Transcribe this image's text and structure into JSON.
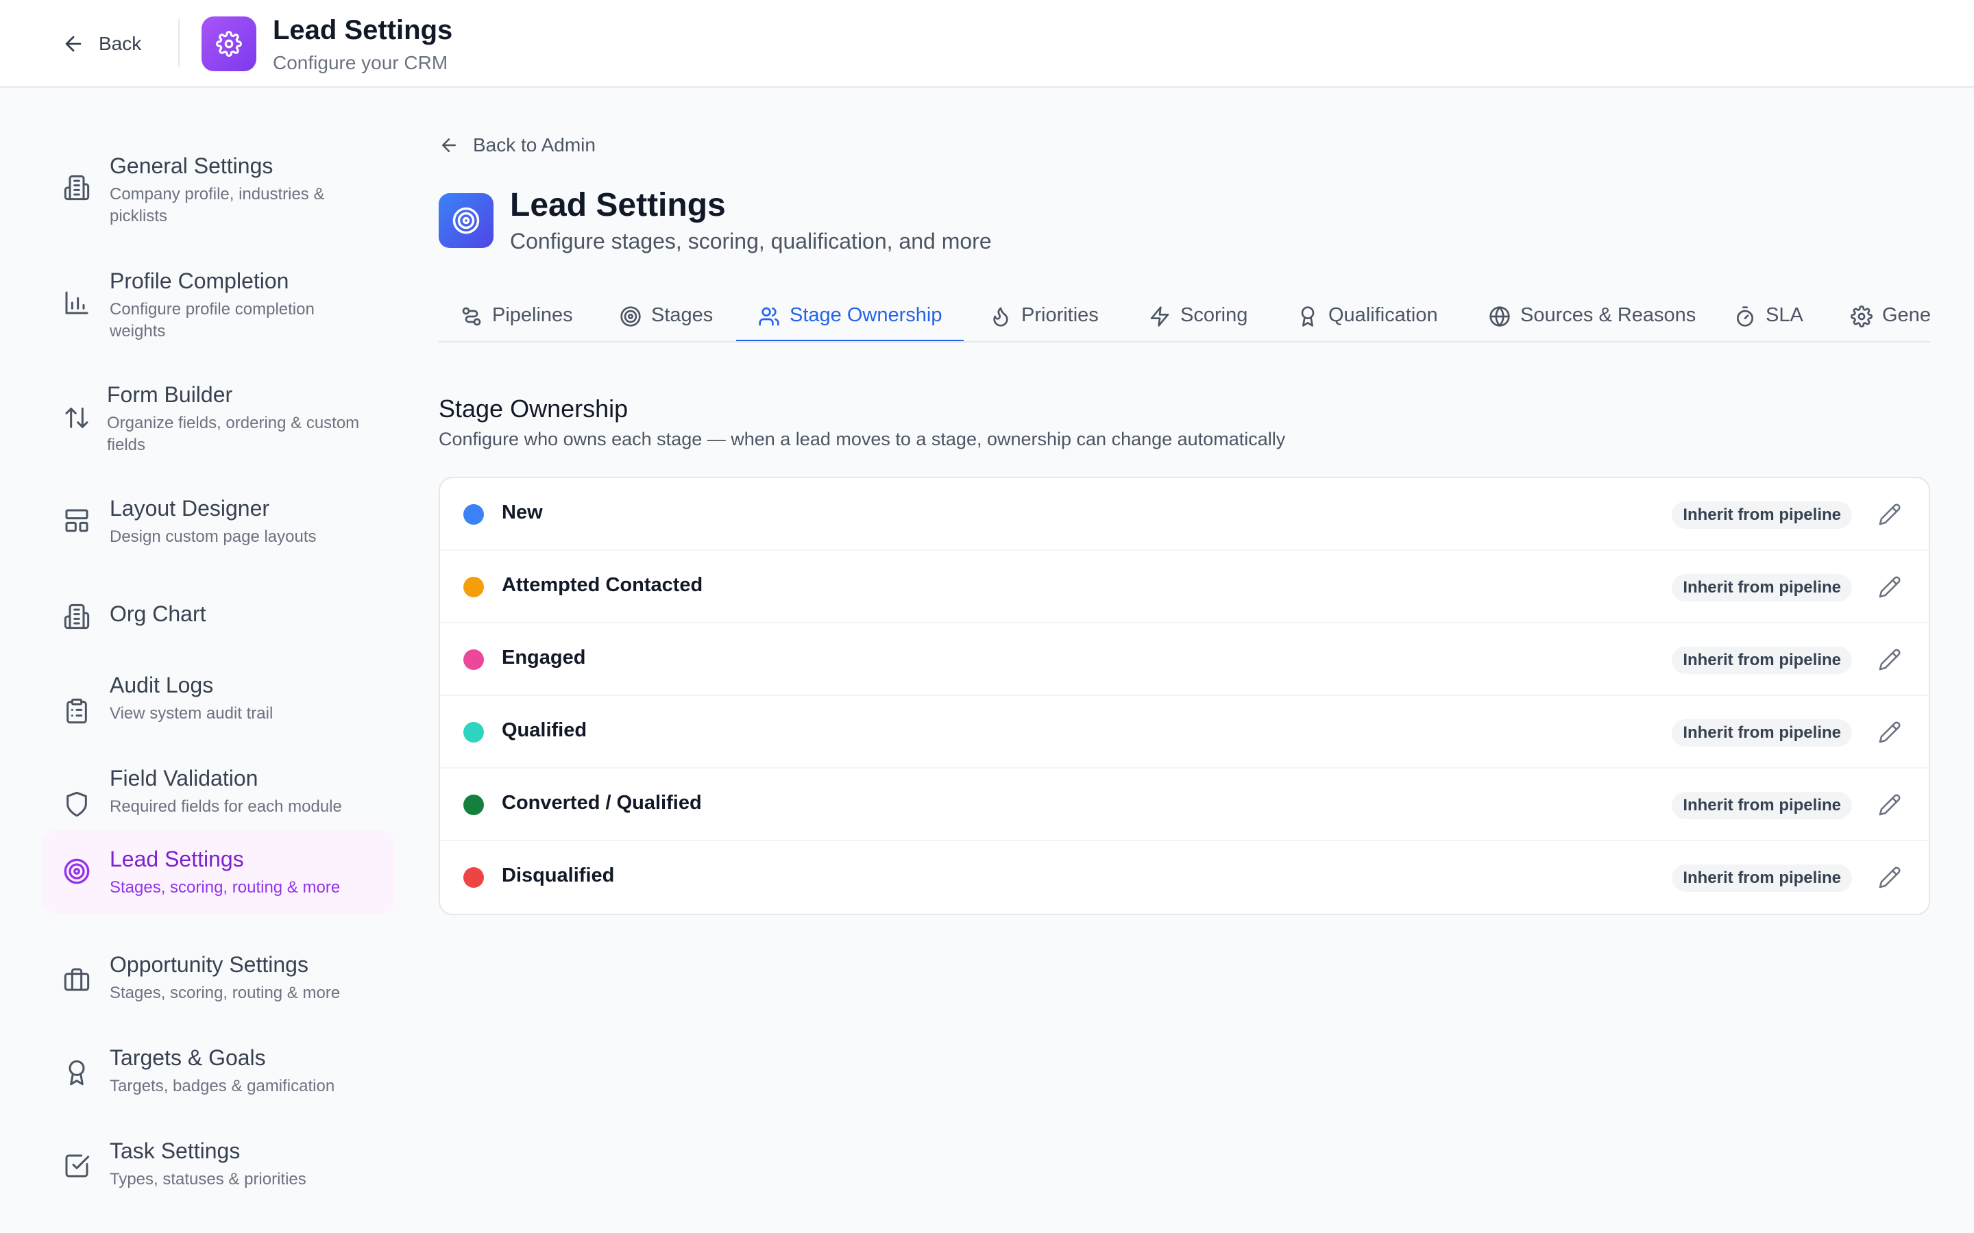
{
  "topbar": {
    "back_label": "Back",
    "title": "Lead Settings",
    "subtitle": "Configure your CRM",
    "icon": "gear-icon"
  },
  "sidebar": {
    "items": [
      {
        "title": "General Settings",
        "desc": "Company profile, industries & picklists",
        "icon": "building-icon"
      },
      {
        "title": "Profile Completion",
        "desc": "Configure profile completion weights",
        "icon": "bar-chart-icon"
      },
      {
        "title": "Form Builder",
        "desc": "Organize fields, ordering & custom fields",
        "icon": "sort-arrows-icon"
      },
      {
        "title": "Layout Designer",
        "desc": "Design custom page layouts",
        "icon": "layout-icon"
      },
      {
        "title": "Org Chart",
        "desc": "",
        "icon": "building-icon"
      },
      {
        "title": "Audit Logs",
        "desc": "View system audit trail",
        "icon": "clipboard-icon"
      },
      {
        "title": "Field Validation",
        "desc": "Required fields for each module",
        "icon": "shield-icon"
      },
      {
        "title": "Lead Settings",
        "desc": "Stages, scoring, routing & more",
        "icon": "target-icon",
        "active": true
      },
      {
        "title": "Opportunity Settings",
        "desc": "Stages, scoring, routing & more",
        "icon": "briefcase-icon"
      },
      {
        "title": "Targets & Goals",
        "desc": "Targets, badges & gamification",
        "icon": "award-icon"
      },
      {
        "title": "Task Settings",
        "desc": "Types, statuses & priorities",
        "icon": "checkbox-icon"
      }
    ]
  },
  "main": {
    "back_label": "Back to Admin",
    "title": "Lead Settings",
    "subtitle": "Configure stages, scoring, qualification, and more",
    "icon": "target-icon",
    "tabs": [
      {
        "label": "Pipelines",
        "icon": "pipeline-icon"
      },
      {
        "label": "Stages",
        "icon": "target-icon"
      },
      {
        "label": "Stage Ownership",
        "icon": "users-icon",
        "active": true
      },
      {
        "label": "Priorities",
        "icon": "flame-icon"
      },
      {
        "label": "Scoring",
        "icon": "bolt-icon"
      },
      {
        "label": "Qualification",
        "icon": "award-icon"
      },
      {
        "label": "Sources & Reasons",
        "icon": "globe-icon"
      },
      {
        "label": "SLA",
        "icon": "timer-icon"
      },
      {
        "label": "Gene",
        "icon": "gear-icon"
      }
    ],
    "section": {
      "title": "Stage Ownership",
      "description": "Configure who owns each stage — when a lead moves to a stage, ownership can change automatically"
    },
    "stages": [
      {
        "name": "New",
        "color": "#3b82f6",
        "owner": "Inherit from pipeline"
      },
      {
        "name": "Attempted Contacted",
        "color": "#f59e0b",
        "owner": "Inherit from pipeline"
      },
      {
        "name": "Engaged",
        "color": "#ec4899",
        "owner": "Inherit from pipeline"
      },
      {
        "name": "Qualified",
        "color": "#2dd4bf",
        "owner": "Inherit from pipeline"
      },
      {
        "name": "Converted / Qualified",
        "color": "#15803d",
        "owner": "Inherit from pipeline"
      },
      {
        "name": "Disqualified",
        "color": "#ef4444",
        "owner": "Inherit from pipeline"
      }
    ]
  }
}
